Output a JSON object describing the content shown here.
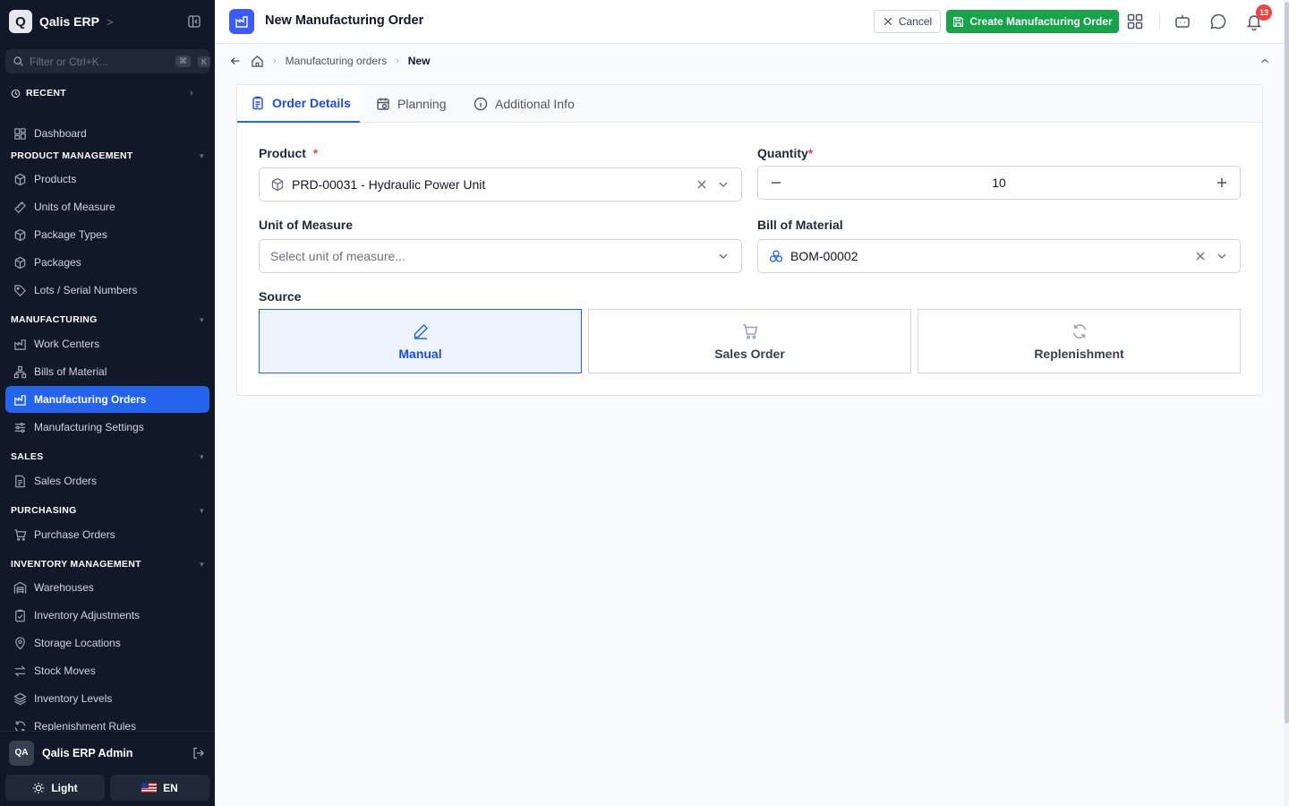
{
  "app": {
    "logo_letter": "Q",
    "name": "Qalis ERP",
    "name_chevron": ">"
  },
  "sidebar": {
    "filter_placeholder": "Filter or Ctrl+K...",
    "kbd_cmd": "⌘",
    "kbd_key": "K",
    "recent_label": "RECENT",
    "dashboard": "Dashboard",
    "sections": {
      "product_management": "PRODUCT MANAGEMENT",
      "manufacturing": "MANUFACTURING",
      "sales": "SALES",
      "purchasing": "PURCHASING",
      "inventory_management": "INVENTORY MANAGEMENT"
    },
    "items": {
      "products": "Products",
      "units_of_measure": "Units of Measure",
      "package_types": "Package Types",
      "packages": "Packages",
      "lots_serial_numbers": "Lots / Serial Numbers",
      "work_centers": "Work Centers",
      "bills_of_material": "Bills of Material",
      "manufacturing_orders": "Manufacturing Orders",
      "manufacturing_settings": "Manufacturing Settings",
      "sales_orders": "Sales Orders",
      "purchase_orders": "Purchase Orders",
      "warehouses": "Warehouses",
      "inventory_adjustments": "Inventory Adjustments",
      "storage_locations": "Storage Locations",
      "stock_moves": "Stock Moves",
      "inventory_levels": "Inventory Levels",
      "replenishment_rules": "Replenishment Rules"
    },
    "active_item": "manufacturing_orders",
    "user": {
      "initials": "QA",
      "name": "Qalis ERP Admin"
    },
    "theme_label": "Light",
    "language_label": "EN"
  },
  "header": {
    "title": "New Manufacturing Order",
    "cancel_label": "Cancel",
    "create_label": "Create Manufacturing Order",
    "notification_count": "13"
  },
  "breadcrumb": {
    "parent": "Manufacturing orders",
    "current": "New"
  },
  "tabs": [
    "Order Details",
    "Planning",
    "Additional Info"
  ],
  "form": {
    "product_label": "Product",
    "product_value": "PRD-00031 - Hydraulic Power Unit",
    "quantity_label": "Quantity",
    "quantity_value": "10",
    "uom_label": "Unit of Measure",
    "uom_placeholder": "Select unit of measure...",
    "bom_label": "Bill of Material",
    "bom_value": "BOM-00002",
    "required_mark": "*",
    "source_label": "Source",
    "source_options": [
      "Manual",
      "Sales Order",
      "Replenishment"
    ],
    "source_selected": "Manual"
  },
  "colors": {
    "sidebar_bg": "#111827",
    "accent": "#2563eb",
    "primary_action": "#16a34a",
    "badge": "#ef4444"
  }
}
